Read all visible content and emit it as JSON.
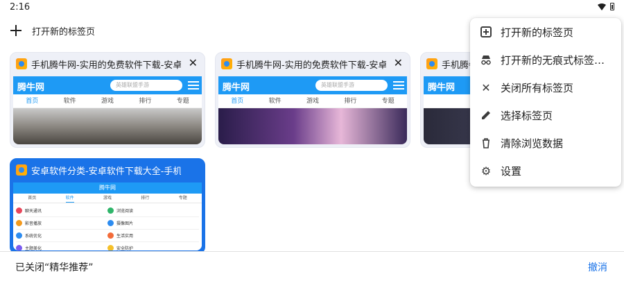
{
  "status": {
    "time": "2:16"
  },
  "toolbar": {
    "new_tab_label": "打开新的标签页"
  },
  "tabs": [
    {
      "title": "手机腾牛网-实用的免费软件下载-安卓",
      "site": {
        "logo": "腾牛网",
        "search_placeholder": "英雄联盟手游",
        "nav": [
          "首页",
          "软件",
          "游戏",
          "排行",
          "专题"
        ]
      }
    },
    {
      "title": "手机腾牛网-实用的免费软件下载-安卓",
      "site": {
        "logo": "腾牛网",
        "search_placeholder": "英雄联盟手游",
        "nav": [
          "首页",
          "软件",
          "游戏",
          "排行",
          "专题"
        ]
      }
    },
    {
      "title": "手机腾牛网",
      "site": {
        "logo": "腾牛网"
      }
    },
    {
      "title": "安卓软件分类-安卓软件下载大全-手机",
      "active": true,
      "site": {
        "logo": "腾牛网",
        "nav": [
          "首页",
          "软件",
          "游戏",
          "排行",
          "专题"
        ],
        "rows": [
          [
            "聊天通讯",
            "浏览阅读"
          ],
          [
            "影音播放",
            "摄像图片"
          ],
          [
            "系统优化",
            "生活实用"
          ],
          [
            "主题美化",
            "安全防护"
          ]
        ]
      }
    }
  ],
  "menu": {
    "items": [
      {
        "label": "打开新的标签页",
        "icon": "add-box-icon"
      },
      {
        "label": "打开新的无痕式标签…",
        "icon": "incognito-icon"
      },
      {
        "label": "关闭所有标签页",
        "icon": "close-icon"
      },
      {
        "label": "选择标签页",
        "icon": "pencil-icon"
      },
      {
        "label": "清除浏览数据",
        "icon": "trash-icon"
      },
      {
        "label": "设置",
        "icon": "gear-icon"
      }
    ]
  },
  "snackbar": {
    "message": "已关闭“精华推荐”",
    "action": "撤消"
  },
  "colors": {
    "accent": "#1a73e8",
    "site_blue": "#1e9af5",
    "card_bg": "#eef0f7"
  }
}
